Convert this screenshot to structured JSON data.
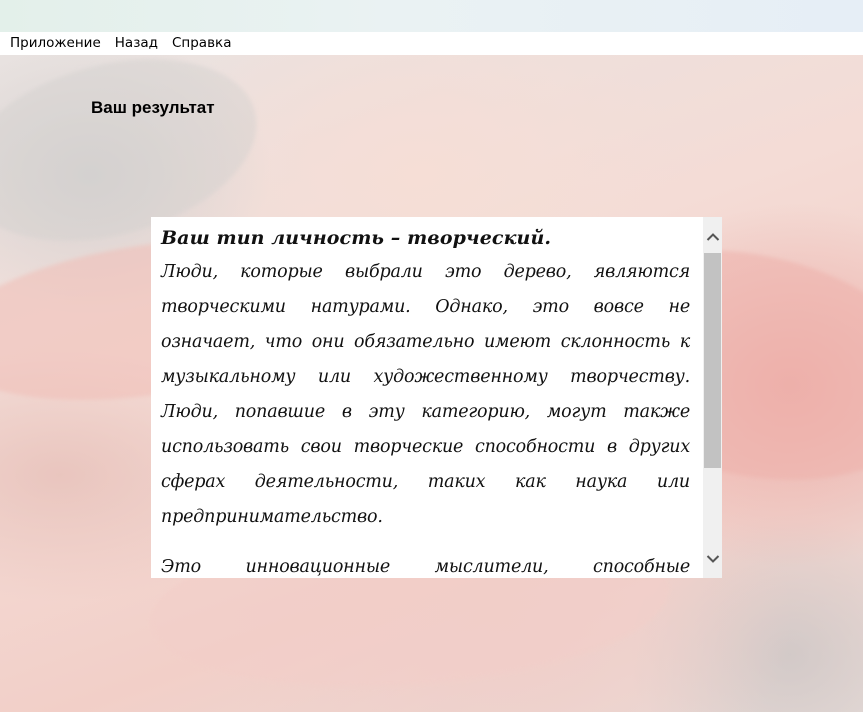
{
  "menu": {
    "items": [
      "Приложение",
      "Назад",
      "Справка"
    ]
  },
  "page": {
    "heading": "Ваш результат"
  },
  "result": {
    "title": "Ваш тип личность – творческий.",
    "paragraphs": [
      "Люди, которые выбрали это дерево, являются творческими натурами. Однако, это вовсе не означает, что они обязательно имеют склонность к музыкальному или художественному творчеству. Люди, попавшие в эту категорию, могут также использовать свои творческие способности в других сферах деятельности, таких как наука или предпринимательство.",
      "Это инновационные мыслители, способные предложить"
    ]
  },
  "icons": {
    "scroll_up": "chevron-up-icon",
    "scroll_down": "chevron-down-icon"
  },
  "colors": {
    "panel_background": "#ffffff",
    "scroll_track": "#f0f0f0",
    "scroll_thumb": "#c2c2c2"
  }
}
